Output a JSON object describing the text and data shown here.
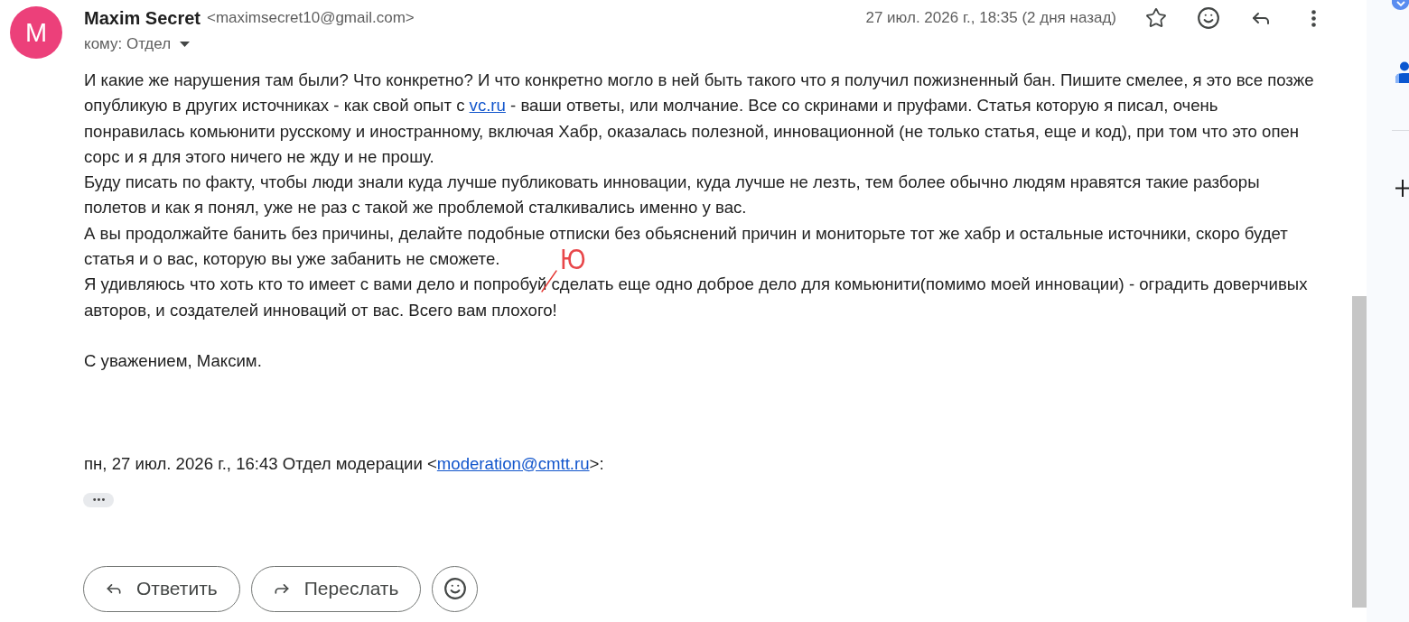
{
  "message": {
    "avatar_letter": "M",
    "sender_name": "Maxim Secret",
    "sender_email": "<maximsecret10@gmail.com>",
    "recipient": "кому: Отдел",
    "date": "27 июл. 2026 г., 18:35 (2 дня назад)",
    "starred": false
  },
  "body": {
    "paragraphs": [
      {
        "parts": [
          {
            "kind": "text",
            "text": "И какие же нарушения там были? Что конкретно? И что конкретно могло в ней быть такого что я получил пожизненный бан. Пишите смелее, я это все позже опубликую в других источниках - как свой опыт с "
          },
          {
            "kind": "link",
            "text": "vc.ru"
          },
          {
            "kind": "text",
            "text": " - ваши ответы, или молчание. Все со скринами и пруфами. Статья которую я писал, очень понравилась комьюнити русскому и иностранному, включая Хабр, оказалась полезной, инновационной (не только статья, еще и код), при том что это опен сорс и я для этого ничего не жду и не прошу."
          }
        ]
      },
      {
        "parts": [
          {
            "kind": "text",
            "text": "Буду писать по факту, чтобы люди знали куда лучше публиковать инновации, куда лучше не лезть, тем более обычно людям нравятся такие разборы полетов и как я понял, уже не раз с такой же проблемой сталкивались именно у вас."
          }
        ]
      },
      {
        "parts": [
          {
            "kind": "text",
            "text": "А вы продолжайте банить без причины, делайте подобные отписки без обьяснений причин и мониторьте тот же хабр и остальные источники, скоро будет статья и о вас, которую вы уже забанить не сможете."
          }
        ]
      },
      {
        "parts": [
          {
            "kind": "text",
            "text": "Я удивляюсь что хоть кто то имеет с вами дело и попробуй"
          },
          {
            "kind": "correction",
            "text": "Ю"
          },
          {
            "kind": "text",
            "text": " сделать еще одно доброе дело для комьюнити(помимо моей инновации) - оградить доверчивых авторов, и создателей инноваций от вас. Всего вам плохого!"
          }
        ]
      }
    ],
    "signature": "С уважением, Максим."
  },
  "quoted": {
    "header": [
      {
        "kind": "text",
        "text": "пн, 27 июл. 2026 г., 16:43 Отдел модерации <"
      },
      {
        "kind": "link",
        "text": "moderation@cmtt.ru"
      },
      {
        "kind": "text",
        "text": ">:"
      }
    ],
    "expand_label": "•••"
  },
  "actions": [
    {
      "kind": "reply",
      "label": "Ответить"
    },
    {
      "kind": "forward",
      "label": "Переслать"
    },
    {
      "kind": "emoji"
    }
  ]
}
